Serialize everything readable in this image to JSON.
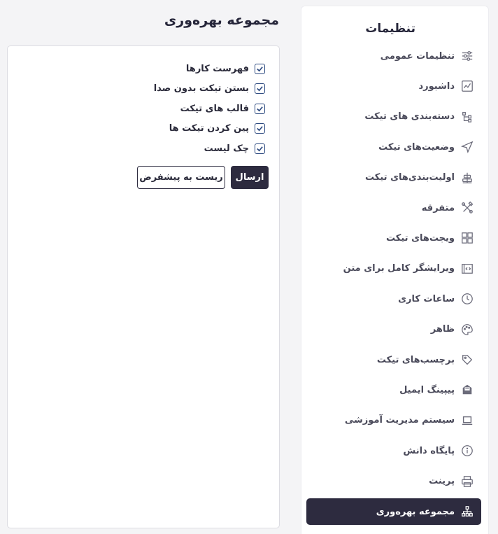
{
  "sidebar": {
    "title": "تنظیمات",
    "items": [
      {
        "label": "تنظیمات عمومی",
        "icon": "sliders-icon"
      },
      {
        "label": "داشبورد",
        "icon": "chart-icon"
      },
      {
        "label": "دسته‌بندی های تیکت",
        "icon": "hierarchy-icon"
      },
      {
        "label": "وضعیت‌های تیکت",
        "icon": "send-icon"
      },
      {
        "label": "اولیت‌بندی‌های تیکت",
        "icon": "priority-icon"
      },
      {
        "label": "متفرقه",
        "icon": "tools-icon"
      },
      {
        "label": "ویجت‌های تیکت",
        "icon": "grid-icon"
      },
      {
        "label": "ویرایشگر کامل برای متن",
        "icon": "code-icon"
      },
      {
        "label": "ساعات کاری",
        "icon": "clock-icon"
      },
      {
        "label": "ظاهر",
        "icon": "palette-icon"
      },
      {
        "label": "برچسب‌های تیکت",
        "icon": "tag-icon"
      },
      {
        "label": "پیپینگ ایمیل",
        "icon": "email-icon"
      },
      {
        "label": "سیستم مدیریت آموزشی",
        "icon": "laptop-icon"
      },
      {
        "label": "پایگاه دانش",
        "icon": "info-icon"
      },
      {
        "label": "پرینت",
        "icon": "printer-icon"
      },
      {
        "label": "مجموعه بهره‌وری",
        "icon": "sitemap-icon",
        "active": true
      }
    ]
  },
  "main": {
    "title": "مجموعه بهره‌وری",
    "options": [
      {
        "label": "فهرست کارها",
        "checked": true
      },
      {
        "label": "بستن تیکت بدون صدا",
        "checked": true
      },
      {
        "label": "قالب های تیکت",
        "checked": true
      },
      {
        "label": "پین کردن تیکت ها",
        "checked": true
      },
      {
        "label": "چک لیست",
        "checked": true
      }
    ],
    "submit_label": "ارسال",
    "reset_label": "ریست به پیشفرض"
  },
  "colors": {
    "accent": "#2d2b3f",
    "checkbox": "#2d4a80"
  }
}
